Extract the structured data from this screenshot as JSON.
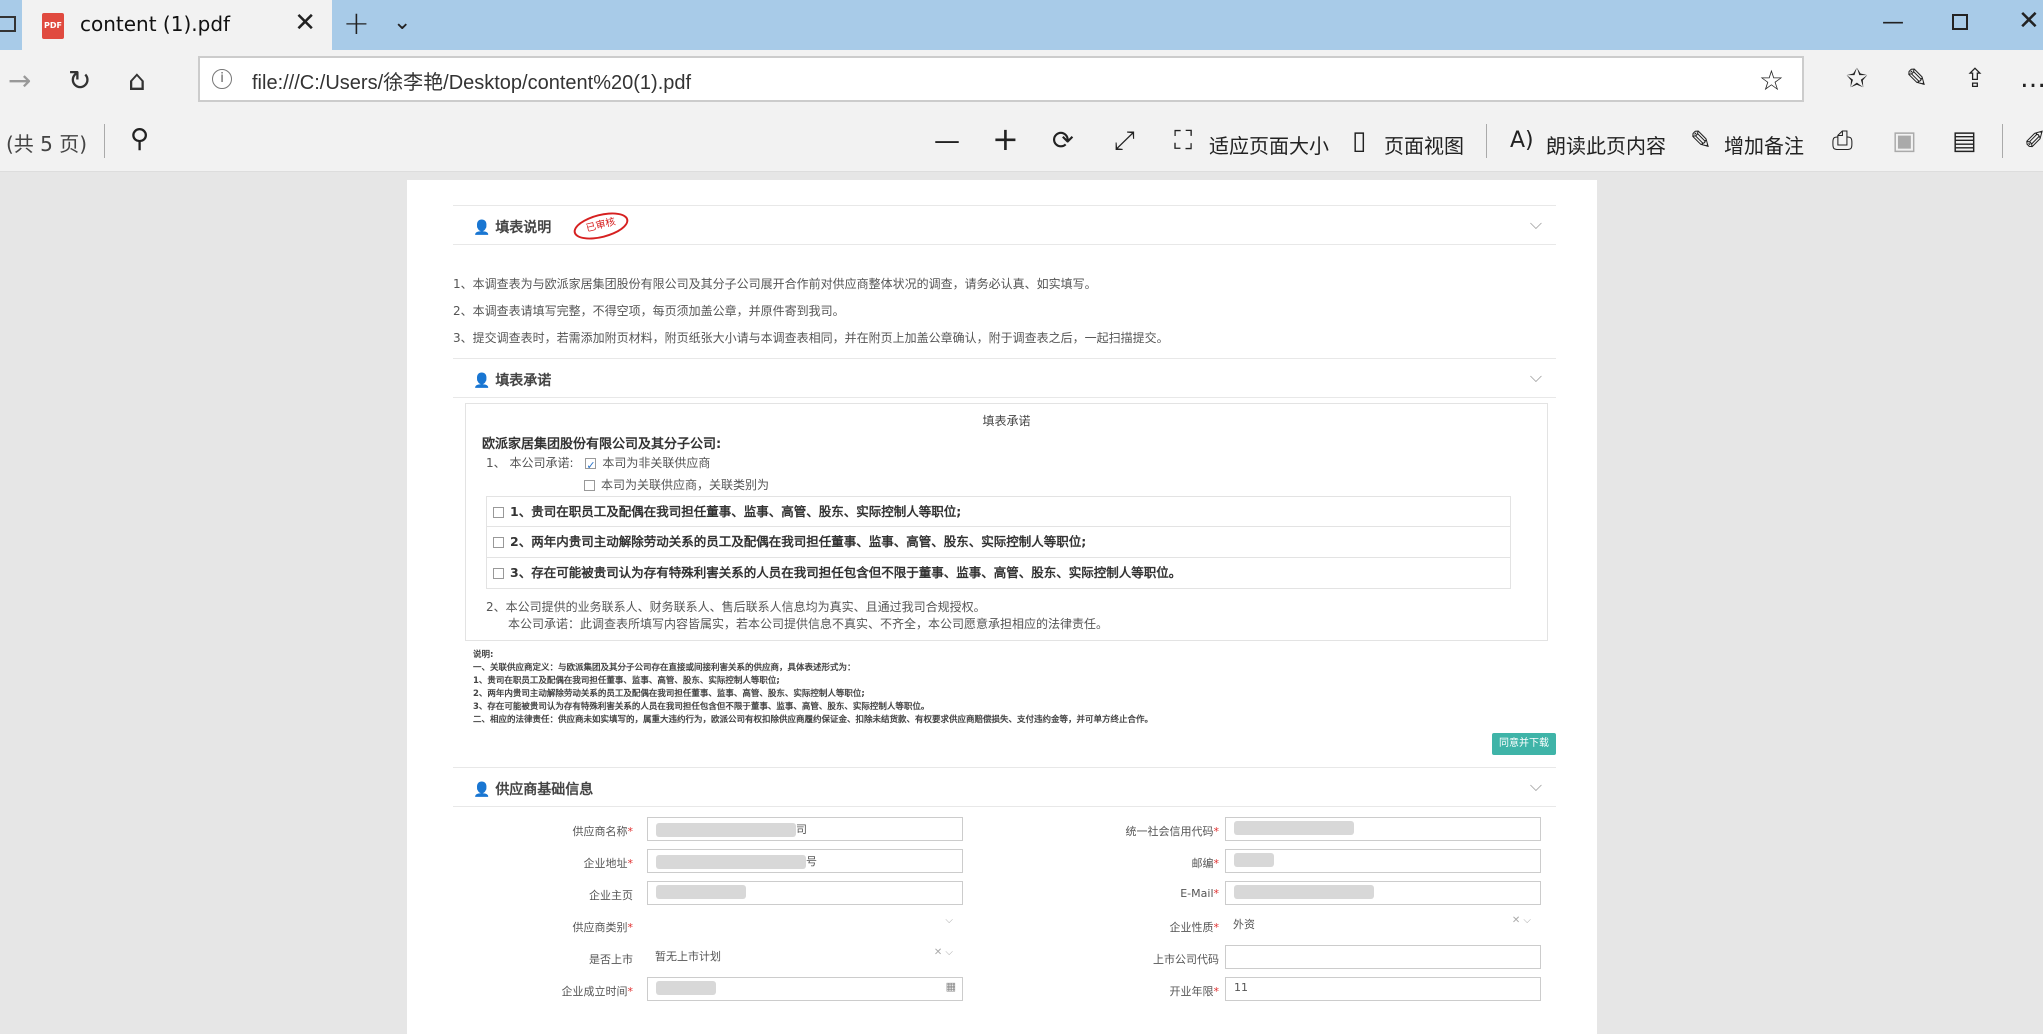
{
  "titlebar": {
    "tab_title": "content (1).pdf",
    "tab_icon": "PDF",
    "close_tab": "✕",
    "new_tab": "+",
    "tab_list": "⌄",
    "min": "—",
    "close_window": "✕"
  },
  "navbar": {
    "url": "file:///C:/Users/徐李艳/Desktop/content%20(1).pdf"
  },
  "pdf_toolbar": {
    "page_count": "(共 5 页)",
    "fit_page": "适应页面大小",
    "page_view": "页面视图",
    "read_aloud": "朗读此页内容",
    "add_notes": "增加备注"
  },
  "doc": {
    "sec1_title": "填表说明",
    "stamp": "已审核",
    "notes": [
      "1、本调查表为与欧派家居集团股份有限公司及其分子公司展开合作前对供应商整体状况的调查，请务必认真、如实填写。",
      "2、本调查表请填写完整，不得空项，每页须加盖公章，并原件寄到我司。",
      "3、提交调查表时，若需添加附页材料，附页纸张大小请与本调查表相同，并在附页上加盖公章确认，附于调查表之后，一起扫描提交。"
    ],
    "sec2_title": "填表承诺",
    "pledge_title": "填表承诺",
    "pledge_company": "欧派家居集团股份有限公司及其分子公司:",
    "pledge_1_prefix": "1、 本公司承诺:",
    "pledge_opt_a": "本司为非关联供应商",
    "pledge_opt_b": "本司为关联供应商，关联类别为",
    "items": [
      "1、贵司在职员工及配偶在我司担任董事、监事、高管、股东、实际控制人等职位;",
      "2、两年内贵司主动解除劳动关系的员工及配偶在我司担任董事、监事、高管、股东、实际控制人等职位;",
      "3、存在可能被贵司认为存有特殊利害关系的人员在我司担任包含但不限于董事、监事、高管、股东、实际控制人等职位。"
    ],
    "pledge_2a": "2、本公司提供的业务联系人、财务联系人、售后联系人信息均为真实、且通过我司合规授权。",
    "pledge_2b": "本公司承诺：此调查表所填写内容皆属实，若本公司提供信息不真实、不齐全，本公司愿意承担相应的法律责任。",
    "small_notes": [
      "说明:",
      "一、关联供应商定义：与欧派集团及其分子公司存在直接或间接利害关系的供应商，具体表述形式为：",
      "1、贵司在职员工及配偶在我司担任董事、监事、高管、股东、实际控制人等职位;",
      "2、两年内贵司主动解除劳动关系的员工及配偶在我司担任董事、监事、高管、股东、实际控制人等职位;",
      "3、存在可能被贵司认为存有特殊利害关系的人员在我司担任包含但不限于董事、监事、高管、股东、实际控制人等职位。",
      "二、相应的法律责任：供应商未如实填写的，属重大违约行为，欧派公司有权扣除供应商履约保证金、扣除未结货款、有权要求供应商赔偿损失、支付违约金等，并可单方终止合作。"
    ],
    "agree_btn": "同意并下载",
    "sec3_title": "供应商基础信息",
    "form": {
      "supplier_name": "供应商名称",
      "supplier_name_tail": "司",
      "credit_code": "统一社会信用代码",
      "address": "企业地址",
      "address_tail": "号",
      "postcode": "邮编",
      "homepage": "企业主页",
      "email": "E-Mail",
      "supplier_type": "供应商类别",
      "nature": "企业性质",
      "nature_val": "外资",
      "listed": "是否上市",
      "listed_val": "暂无上市计划",
      "listed_code": "上市公司代码",
      "founded": "企业成立时间",
      "years": "开业年限",
      "years_val": "11",
      "required_mark": "*"
    }
  }
}
